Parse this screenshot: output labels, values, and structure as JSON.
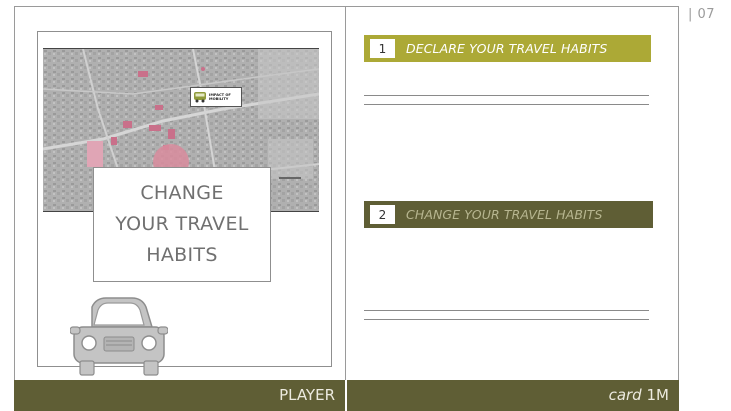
{
  "page_number": "| 07",
  "left_card": {
    "title_lines": [
      "CHANGE",
      "YOUR TRAVEL",
      "HABITS"
    ],
    "map_callout": "IMPACT OF\nMOBILITY",
    "footer_label": "PLAYER"
  },
  "right_card": {
    "steps": [
      {
        "number": "1",
        "label": "DECLARE YOUR TRAVEL HABITS"
      },
      {
        "number": "2",
        "label": "CHANGE YOUR TRAVEL HABITS"
      }
    ],
    "footer_word": "card",
    "footer_code": "1M"
  },
  "colors": {
    "olive_band": "#5f5e35",
    "step_one_bar": "#aca936",
    "step_two_text": "#b7b690",
    "map_highlight": "#d98c9e"
  }
}
